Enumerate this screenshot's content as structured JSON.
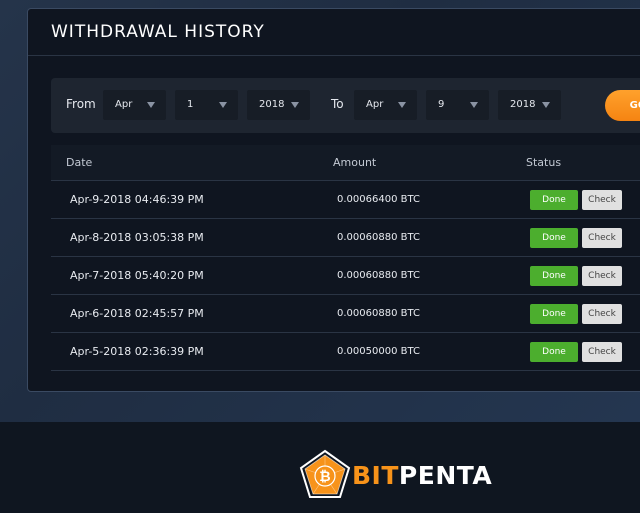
{
  "panel": {
    "title": "WITHDRAWAL HISTORY"
  },
  "filter": {
    "from_label": "From",
    "to_label": "To",
    "from_month": "Apr",
    "from_day": "1",
    "from_year": "2018",
    "to_month": "Apr",
    "to_day": "9",
    "to_year": "2018",
    "go_label": "GO"
  },
  "table": {
    "headers": {
      "date": "Date",
      "amount": "Amount",
      "status": "Status"
    },
    "rows": [
      {
        "date": "Apr-9-2018 04:46:39 PM",
        "amount": "0.00066400 BTC",
        "status": "Done",
        "action": "Check"
      },
      {
        "date": "Apr-8-2018 03:05:38 PM",
        "amount": "0.00060880 BTC",
        "status": "Done",
        "action": "Check"
      },
      {
        "date": "Apr-7-2018 05:40:20 PM",
        "amount": "0.00060880 BTC",
        "status": "Done",
        "action": "Check"
      },
      {
        "date": "Apr-6-2018 02:45:57 PM",
        "amount": "0.00060880 BTC",
        "status": "Done",
        "action": "Check"
      },
      {
        "date": "Apr-5-2018 02:36:39 PM",
        "amount": "0.00050000 BTC",
        "status": "Done",
        "action": "Check"
      }
    ]
  },
  "brand": {
    "logo_text_part1": "BIT",
    "logo_text_part2": "PENTA",
    "logo_icon_letter": "₿"
  },
  "colors": {
    "accent_orange": "#f7931a",
    "done_green": "#4cae2e",
    "panel_bg": "#0f1520",
    "page_bg": "#1e2a3b"
  }
}
